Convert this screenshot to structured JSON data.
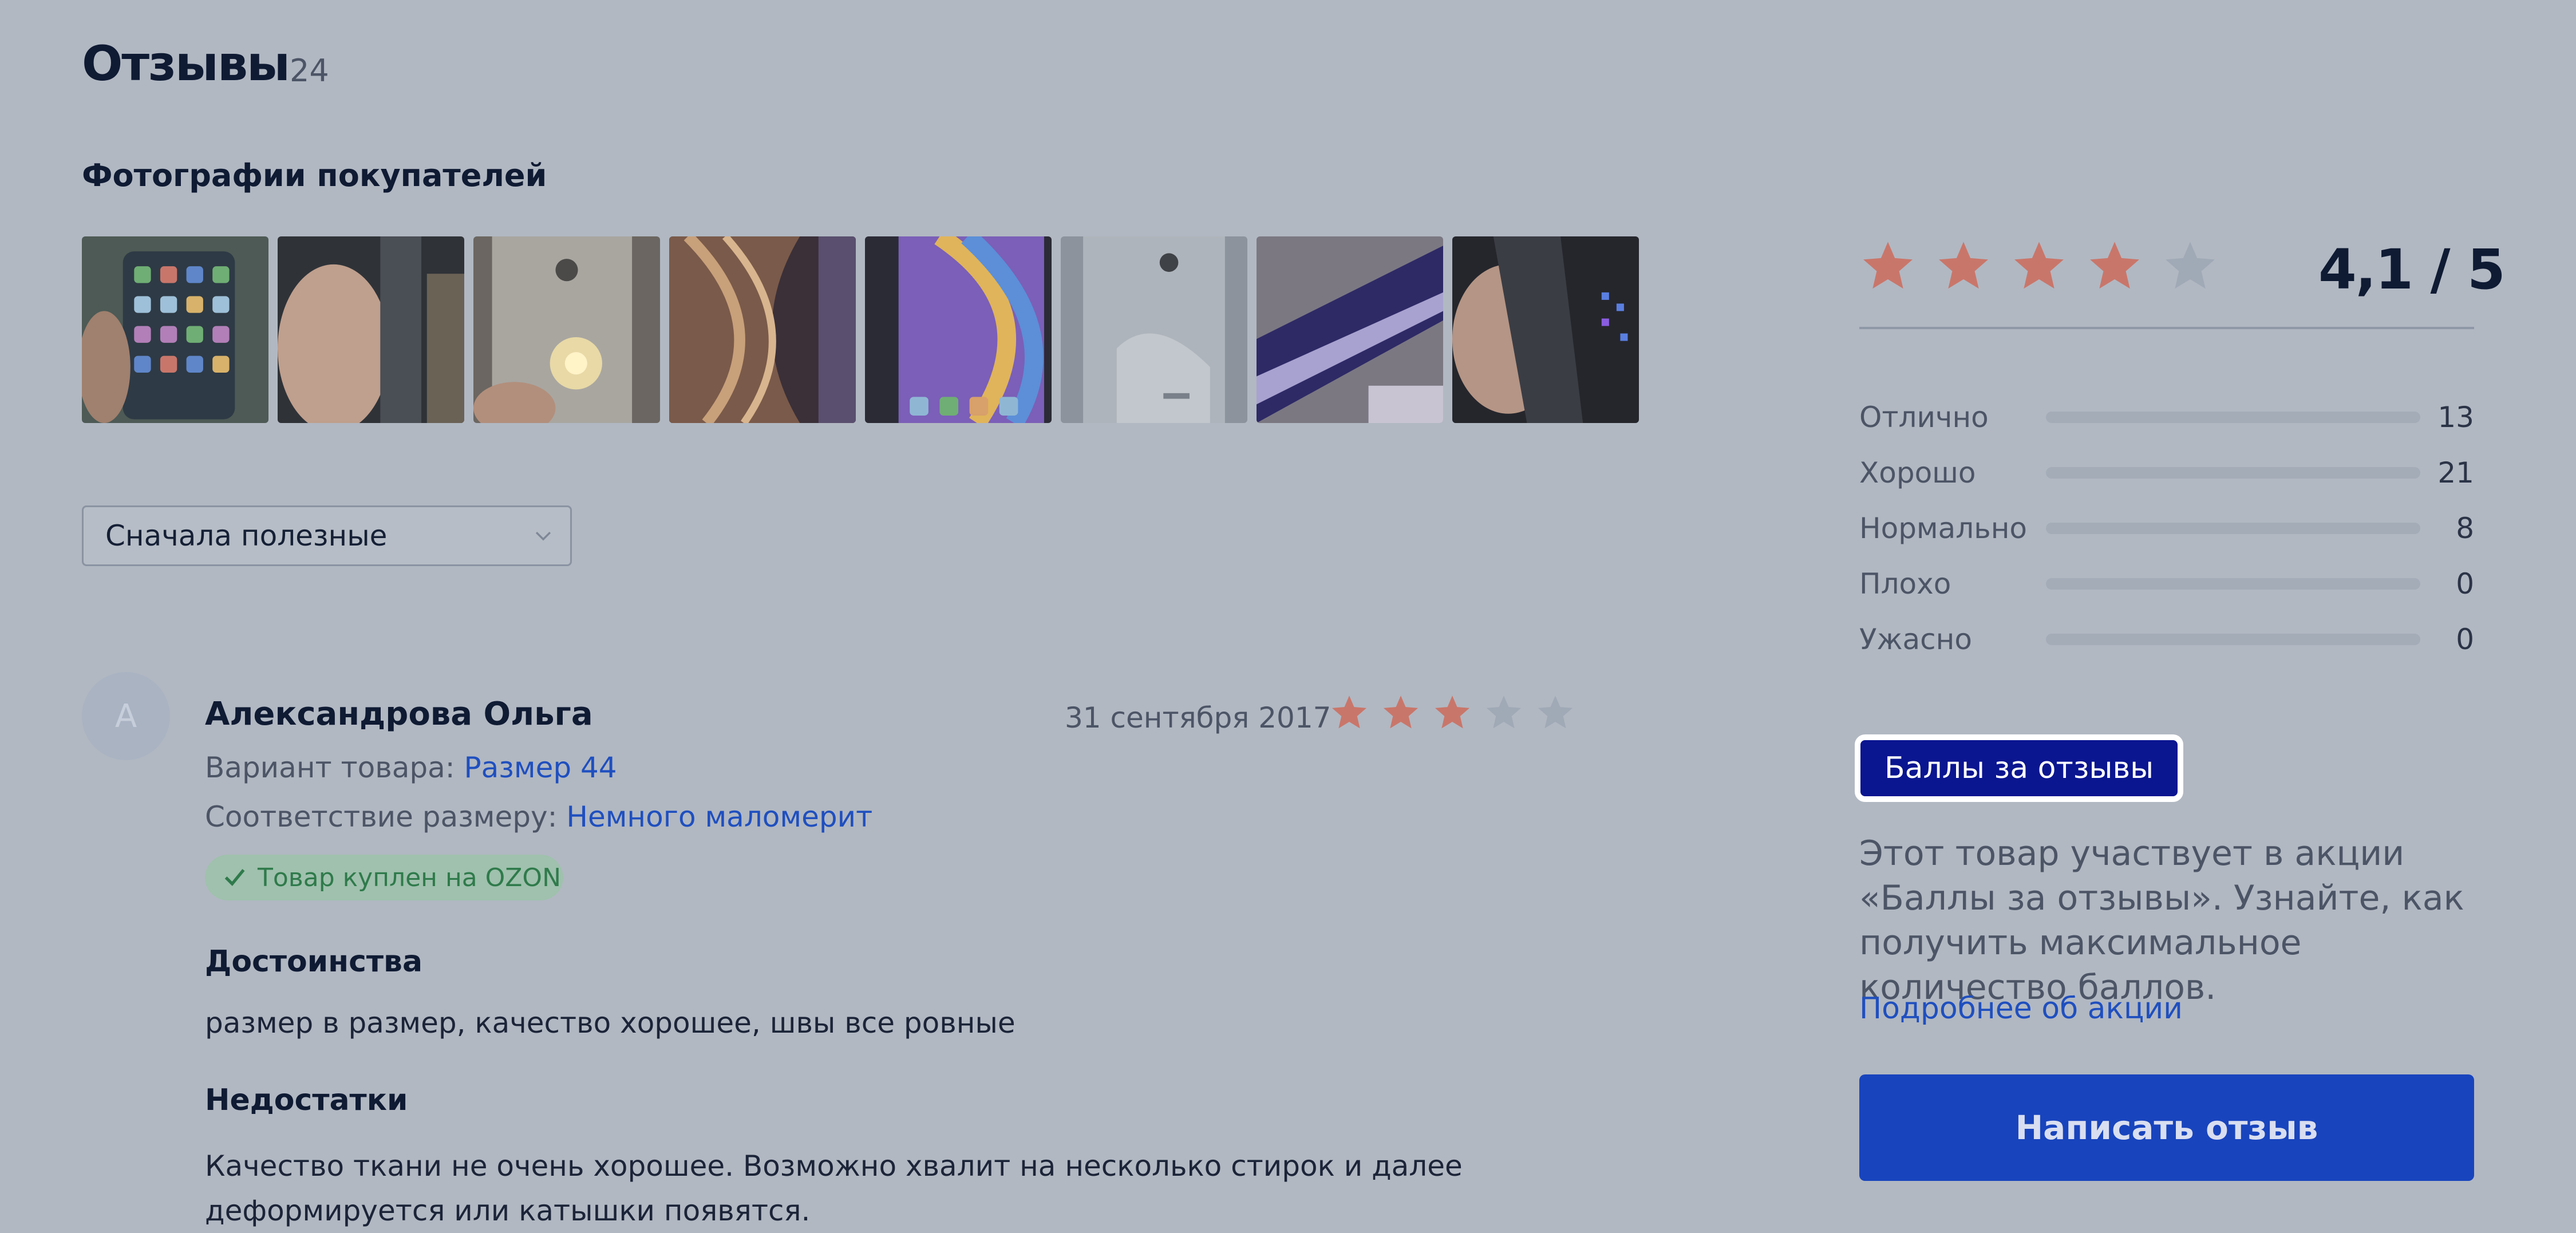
{
  "header": {
    "title": "Отзывы",
    "count": "24"
  },
  "photos": {
    "heading": "Фотографии покупателей",
    "items": [
      "photo-1",
      "photo-2",
      "photo-3",
      "photo-4",
      "photo-5",
      "photo-6",
      "photo-7",
      "photo-8"
    ]
  },
  "sort": {
    "selected": "Сначала полезные"
  },
  "review": {
    "avatar_initial": "А",
    "author": "Александрова Ольга",
    "date": "31 сентября 2017",
    "rating": 3,
    "rating_max": 5,
    "variant_label": "Вариант товара:",
    "variant_value": "Размер 44",
    "fit_label": "Соответствие размеру:",
    "fit_value": "Немного маломерит",
    "badge": "Товар куплен на OZON",
    "pros_heading": "Достоинства",
    "pros_text": "размер в размер, качество хорошее, швы все ровные",
    "cons_heading": "Недостатки",
    "cons_text": "Качество ткани не очень хорошее. Возможно хвалит на несколько стирок и далее деформируется или катышки появятся."
  },
  "summary": {
    "rating_text": "4,1 / 5",
    "rating": 4.1,
    "stars_filled": 4,
    "stars_max": 5,
    "distribution": [
      {
        "label": "Отлично",
        "count": "13"
      },
      {
        "label": "Хорошо",
        "count": "21"
      },
      {
        "label": "Нормально",
        "count": "8"
      },
      {
        "label": "Плохо",
        "count": "0"
      },
      {
        "label": "Ужасно",
        "count": "0"
      }
    ]
  },
  "promo": {
    "button": "Баллы за отзывы",
    "text": "Этот товар участвует в акции «Баллы за отзывы». Узнайте, как получить максимальное количество баллов.",
    "link": "Подробнее об акции",
    "write_button": "Написать отзыв"
  },
  "colors": {
    "star_active": "#c9766a",
    "star_inactive": "#a0a9b6",
    "accent": "#1844bd",
    "badge_text": "#2f7a4b"
  }
}
